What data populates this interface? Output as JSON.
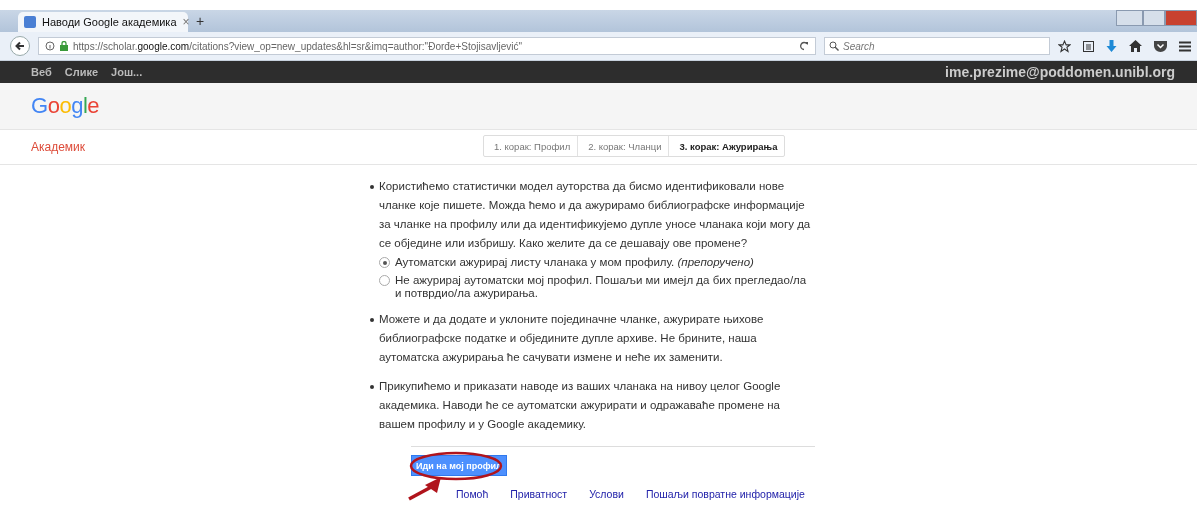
{
  "browser": {
    "tab_title": "Наводи Google академика",
    "tab_close": "×",
    "new_tab": "+",
    "url": "https://scholar.**google.com**/citations?view_op=new_updates&hl=sr&imq=author:\"Đorđe+Stojisavljević\"",
    "search_placeholder": "Search"
  },
  "topbar": {
    "links": [
      "Веб",
      "Слике",
      "Још..."
    ],
    "account": "ime.prezime@poddomen.unibl.org"
  },
  "logo": "Google",
  "section_title": "Академик",
  "steps": [
    {
      "label": "1. корак: Профил",
      "selected": false
    },
    {
      "label": "2. корак: Чланци",
      "selected": false
    },
    {
      "label": "3. корак: Ажурирања",
      "selected": true
    }
  ],
  "intro": "Користићемо статистички модел ауторства да бисмо идентификовали нове чланке које пишете. Можда ћемо и да ажурирамо библиографске информације за чланке на профилу или да идентификујемо дупле уносе чланака који могу да се обједине или избришу. Како желите да се дешавају ове промене?",
  "options": [
    {
      "label": "Аутоматски ажурирај листу чланака у мом профилу. *(препоручено)*",
      "selected": true
    },
    {
      "label": "Не ажурирај аутоматски мој профил. Пошаљи ми имејл да бих прегледао/ла и потврдио/ла ажурирања.",
      "selected": false
    }
  ],
  "notes": [
    "Можете и да додате и уклоните појединачне чланке, ажурирате њихове библиографске податке и обједините дупле архиве. Не брините, наша аутоматска ажурирања ће сачувати измене и неће их заменити.",
    "Прикупићемо и приказати наводе из ваших чланака на нивоу целог Google академика. Наводи ће се аутоматски ажурирати и одражаваће промене на вашем профилу и у Google академику."
  ],
  "button": "Иди на мој профил",
  "footer_links": [
    "Помоћ",
    "Приватност",
    "Услови",
    "Пошаљи повратне информације"
  ]
}
